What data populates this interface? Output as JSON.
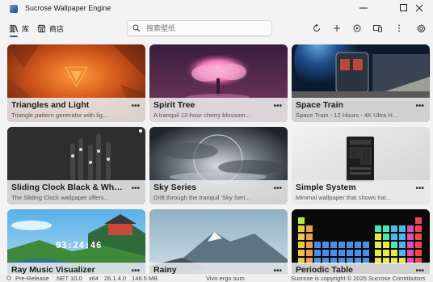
{
  "window": {
    "title": "Sucrose Wallpaper Engine",
    "controls": [
      "minimize-icon",
      "maximize-icon",
      "close-icon"
    ]
  },
  "nav": {
    "tabs": [
      {
        "label": "库",
        "icon": "library-icon",
        "selected": true
      },
      {
        "label": "商店",
        "icon": "store-icon",
        "selected": false
      }
    ],
    "accent": "#1f5aa6"
  },
  "search": {
    "placeholder": "搜索壁纸",
    "value": ""
  },
  "toolbar": {
    "actions": [
      "refresh-icon",
      "add-icon",
      "play-icon",
      "display-icon",
      "more-vertical-icon",
      "settings-icon"
    ]
  },
  "wallpapers": [
    {
      "title": "Triangles and Light",
      "description": "Triangle pattern generator with lig..."
    },
    {
      "title": "Spirit Tree",
      "description": "A tranquil 12-hour cherry blossom..."
    },
    {
      "title": "Space Train",
      "description": "Space Train - 12 Hours - 4K Ultra H..."
    },
    {
      "title": "Sliding Clock Black & Whi...",
      "description": "The Sliding Clock wallpaper offers..."
    },
    {
      "title": "Sky Series",
      "description": "Drift through the tranquil 'Sky Seri..."
    },
    {
      "title": "Simple System",
      "description": "Minimal wallpaper that shows har..."
    },
    {
      "title": "Ray Music Visualizer",
      "description": "",
      "overlay_text": "03:24:46"
    },
    {
      "title": "Rainy",
      "description": ""
    },
    {
      "title": "Periodic Table",
      "description": ""
    }
  ],
  "card_menu_label": "•••",
  "status": {
    "release": "Pre-Release",
    "framework": ".NET 10.0",
    "arch": "x64",
    "version": "26.1.4.0",
    "memory": "148.5 MB",
    "motto": "Vivo ergo sum",
    "copyright": "Sucrose is copyright © 2025 Sucrose Contributors"
  }
}
